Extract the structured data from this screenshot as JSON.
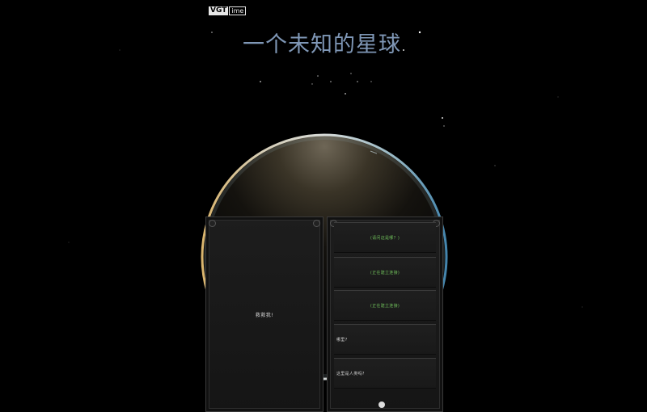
{
  "logo": {
    "badge": "VGT",
    "rest": "ime"
  },
  "title": "一个未知的星球",
  "left_panel": {
    "greeting": "救救我!"
  },
  "right_panel": {
    "choices": [
      {
        "label": "(请问这是哪？)",
        "color": "#6fbf5a"
      },
      {
        "label": "(正在建立连接)",
        "color": "#6fbf5a"
      },
      {
        "label": "(正在建立连接)",
        "color": "#6fbf5a"
      },
      {
        "label": "哪里?",
        "color": "#d0d0d0"
      },
      {
        "label": "这里是人类吗?",
        "color": "#d0d0d0"
      }
    ]
  },
  "colors": {
    "background": "#000000",
    "title": "#7f97b6",
    "choice_green": "#6fbf5a",
    "panel": "#1b1b1b"
  }
}
